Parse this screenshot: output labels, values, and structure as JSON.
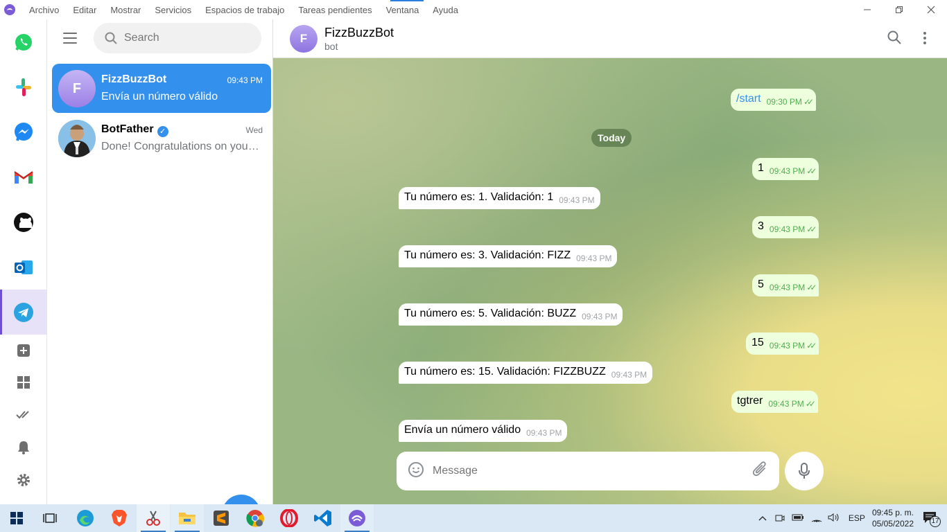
{
  "menubar": {
    "items": [
      "Archivo",
      "Editar",
      "Mostrar",
      "Servicios",
      "Espacios de trabajo",
      "Tareas pendientes",
      "Ventana",
      "Ayuda"
    ]
  },
  "search": {
    "placeholder": "Search"
  },
  "chats": [
    {
      "avatar": "F",
      "name": "FizzBuzzBot",
      "time": "09:43 PM",
      "preview": "Envía un número válido"
    },
    {
      "name": "BotFather",
      "time": "Wed",
      "preview": "Done! Congratulations on your new bot. You will find it at"
    }
  ],
  "header": {
    "avatar": "F",
    "title": "FizzBuzzBot",
    "subtitle": "bot"
  },
  "messages": [
    {
      "dir": "out",
      "text": "/start",
      "time": "09:30 PM"
    },
    {
      "dir": "out",
      "text": "1",
      "time": "09:43 PM"
    },
    {
      "dir": "in",
      "text": "Tu número es: 1. Validación: 1",
      "time": "09:43 PM"
    },
    {
      "dir": "out",
      "text": "3",
      "time": "09:43 PM"
    },
    {
      "dir": "in",
      "text": "Tu número es: 3. Validación: FIZZ",
      "time": "09:43 PM"
    },
    {
      "dir": "out",
      "text": "5",
      "time": "09:43 PM"
    },
    {
      "dir": "in",
      "text": "Tu número es: 5. Validación: BUZZ",
      "time": "09:43 PM"
    },
    {
      "dir": "out",
      "text": "15",
      "time": "09:43 PM"
    },
    {
      "dir": "in",
      "text": "Tu número es: 15. Validación: FIZZBUZZ",
      "time": "09:43 PM"
    },
    {
      "dir": "out",
      "text": "tgtrer",
      "time": "09:43 PM"
    },
    {
      "dir": "in",
      "text": "Envía un número válido",
      "time": "09:43 PM"
    }
  ],
  "date_separator": "Today",
  "composer": {
    "placeholder": "Message"
  },
  "tray": {
    "language": "ESP",
    "time": "09:45 p. m.",
    "date": "05/05/2022",
    "notifications": "17"
  },
  "colors": {
    "accent": "#3390ec",
    "outgoing_bubble": "#eeffde",
    "incoming_bubble": "#ffffff",
    "taskbar": "#d9e8f4"
  }
}
